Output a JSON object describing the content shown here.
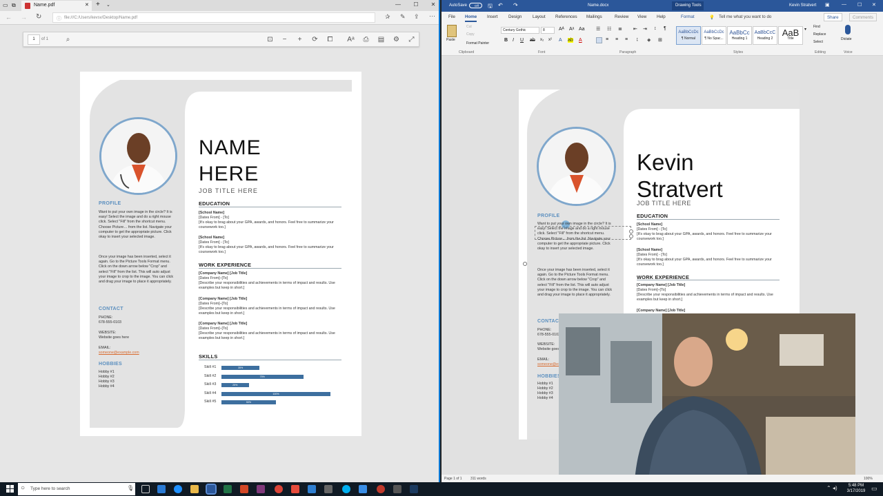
{
  "edge": {
    "tab_title": "Name.pdf",
    "url": "file:///C:/Users/kevsv/Desktop/Name.pdf",
    "page_number": "1",
    "page_of": "of 1"
  },
  "resume_pdf": {
    "name_line1": "NAME",
    "name_line2": "HERE",
    "job_title": "JOB TITLE HERE",
    "profile_head": "PROFILE",
    "profile_p1": "Want to put your own image in the circle? It is easy! Select the image and do a right mouse click. Select \"Fill\" from the shortcut menu. Choose Picture… from the list. Navigate your computer to get the appropriate picture. Click okay to insert your selected image.",
    "profile_p2": "Once your image has been inserted, select it again. Go to the Picture Tools Format menu. Click on the down arrow below \"Crop\" and select \"Fill\" from the list. This will auto adjust your image to crop to the image. You can click and drag your image to place it appropriately.",
    "contact_head": "CONTACT",
    "phone_label": "PHONE:",
    "phone": "678-555-0103",
    "website_label": "WEBSITE:",
    "website": "Website goes here",
    "email_label": "EMAIL:",
    "email": "someone@example.com",
    "hobbies_head": "HOBBIES",
    "hobbies": [
      "Hobby #1",
      "Hobby #2",
      "Hobby #3",
      "Hobby #4"
    ],
    "education_head": "EDUCATION",
    "edu": [
      {
        "school": "[School Name]",
        "dates": "[Dates From] - [To]",
        "desc": "[It's okay to brag about your GPA, awards, and honors. Feel free to summarize your coursework too.]"
      },
      {
        "school": "[School Name]",
        "dates": "[Dates From] - [To]",
        "desc": "[It's okay to brag about your GPA, awards, and honors. Feel free to summarize your coursework too.]"
      }
    ],
    "work_head": "WORK EXPERIENCE",
    "work": [
      {
        "company": "[Company Name]  [Job Title]",
        "dates": "[Dates From]–[To]",
        "desc": "[Describe your responsibilities and achievements in terms of impact and results. Use examples but keep in short.]"
      },
      {
        "company": "[Company Name]  [Job Title]",
        "dates": "[Dates From]–[To]",
        "desc": "[Describe your responsibilities and achievements in terms of impact and results. Use examples but keep in short.]"
      },
      {
        "company": "[Company Name]  [Job Title]",
        "dates": "[Dates From]–[To]",
        "desc": "[Describe your responsibilities and achievements in terms of impact and results. Use examples but keep in short.]"
      }
    ],
    "skills_head": "SKILLS",
    "skills": [
      {
        "label": "Skill #1",
        "fill": 0.35,
        "pct": "35%"
      },
      {
        "label": "Skill #2",
        "fill": 0.75,
        "pct": "75%"
      },
      {
        "label": "Skill #3",
        "fill": 0.25,
        "pct": "25%"
      },
      {
        "label": "Skill #4",
        "fill": 1.0,
        "pct": "100%"
      },
      {
        "label": "Skill #5",
        "fill": 0.5,
        "pct": "50%"
      }
    ]
  },
  "word": {
    "autosave": "AutoSave",
    "autosave_state": "Off",
    "doc_title": "Name.docx",
    "context_tab": "Drawing Tools",
    "user": "Kevin Stratvert",
    "tabs": [
      "File",
      "Home",
      "Insert",
      "Design",
      "Layout",
      "References",
      "Mailings",
      "Review",
      "View",
      "Help",
      "Format"
    ],
    "tell_me": "Tell me what you want to do",
    "share": "Share",
    "comments": "Comments",
    "paste": "Paste",
    "cut": "Cut",
    "copy": "Copy",
    "format_painter": "Format Painter",
    "font_name": "Century Gothic",
    "font_size": "8",
    "styles": [
      {
        "sample": "AaBbCcDc",
        "name": "¶ Normal"
      },
      {
        "sample": "AaBbCcDc",
        "name": "¶ No Spac..."
      },
      {
        "sample": "AaBbCc",
        "name": "Heading 1"
      },
      {
        "sample": "AaBbCcC",
        "name": "Heading 2"
      },
      {
        "sample": "AaB",
        "name": "Title"
      }
    ],
    "find": "Find",
    "replace": "Replace",
    "select": "Select",
    "dictate": "Dictate",
    "groups": [
      "Clipboard",
      "Font",
      "Paragraph",
      "Styles",
      "Editing",
      "Voice"
    ],
    "status_page": "Page 1 of 1",
    "status_words": "311 words",
    "zoom": "100%"
  },
  "resume_word": {
    "name_line1": "Kevin",
    "name_line2": "Stratvert",
    "job_title": "JOB TITLE HERE",
    "profile_head": "PROFILE",
    "profile_p1": "Want to put your own image in the circle? It is easy! Select the image and do a right mouse click. Select \"Fill\" from the shortcut menu. Choose Picture… from the list. Navigate your computer to get the appropriate picture. Click okay to insert your selected image.",
    "profile_p2": "Once your image has been inserted, select it again. Go to the Picture Tools Format menu. Click on the down arrow below \"Crop\" and select \"Fill\" from the list. This will auto adjust your image to crop to the image. You can click and drag your image to place it appropriately.",
    "contact_head": "CONTACT",
    "phone_label": "PHONE:",
    "phone": "678-555-0103",
    "website_label": "WEBSITE:",
    "website": "Website goes here",
    "email_label": "EMAIL:",
    "email": "someone@example.com",
    "hobbies_head": "HOBBIES",
    "hobbies": [
      "Hobby #1",
      "Hobby #2",
      "Hobby #3",
      "Hobby #4"
    ],
    "education_head": "EDUCATION",
    "edu": [
      {
        "school": "[School Name]",
        "dates": "[Dates From] - [To]",
        "desc": "[It's okay to brag about your GPA, awards, and honors. Feel free to summarize your coursework too.]"
      },
      {
        "school": "[School Name]",
        "dates": "[Dates From] - [To]",
        "desc": "[It's okay to brag about your GPA, awards, and honors. Feel free to summarize your coursework too.]"
      }
    ],
    "work_head": "WORK EXPERIENCE",
    "work": [
      {
        "company": "[Company Name]  [Job Title]",
        "dates": "[Dates From]–[To]",
        "desc": "[Describe your responsibilities and achievements in terms of impact and results. Use examples but keep in short.]"
      },
      {
        "company": "[Company Name]  [Job Title]"
      }
    ]
  },
  "taskbar": {
    "search_placeholder": "Type here to search",
    "time": "5:48 PM",
    "date": "3/17/2019"
  },
  "colors": {
    "accent_blue": "#5b8fbf",
    "word_blue": "#2b579a",
    "skill_bar": "#3d6f9f",
    "link": "#d86a2e",
    "panel_grey": "#e3e3e3"
  }
}
